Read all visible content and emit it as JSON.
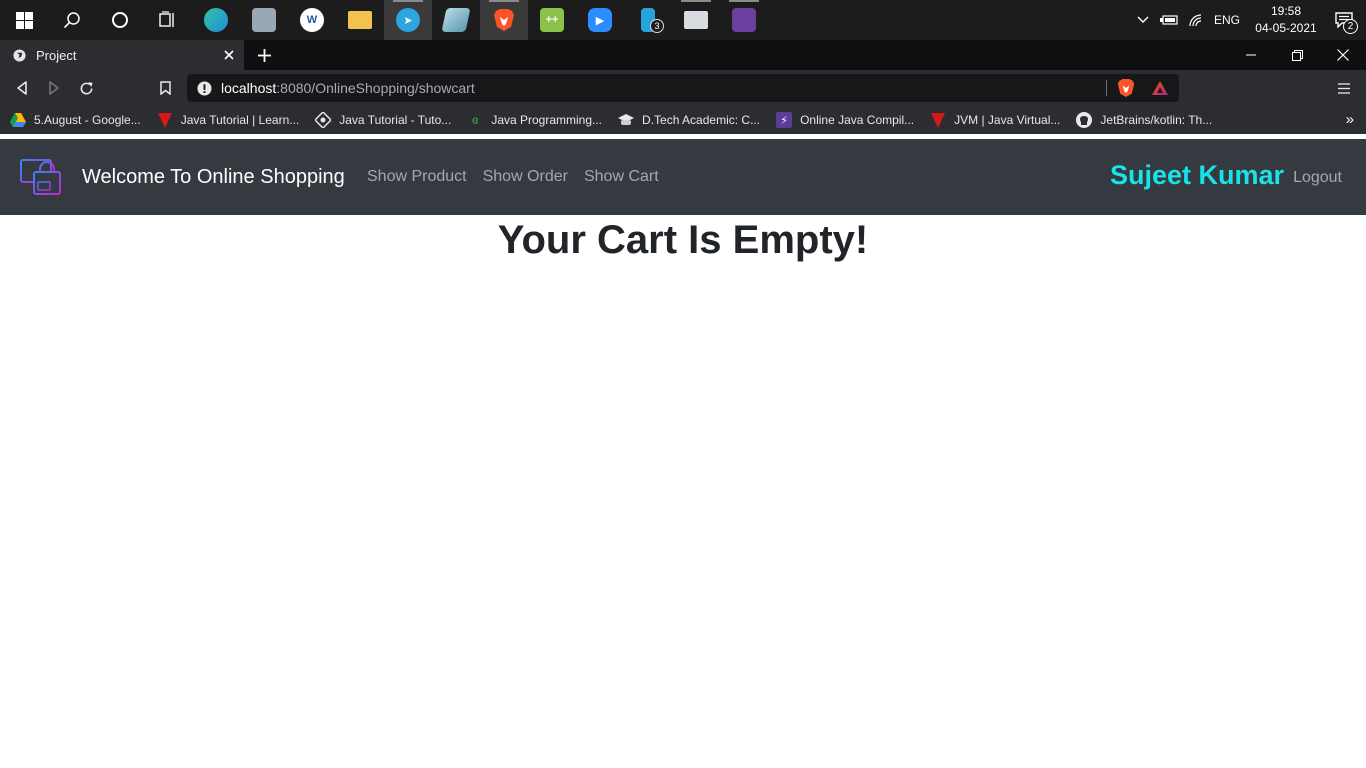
{
  "taskbar": {
    "apps": [
      {
        "icon": "edge-icon",
        "color": "#1e8fd8"
      },
      {
        "icon": "network-tool-icon",
        "color": "#9aa7b5"
      },
      {
        "icon": "word-icon",
        "color": "#ffffff"
      },
      {
        "icon": "file-explorer-icon",
        "color": "#f2c14e"
      },
      {
        "icon": "telegram-icon",
        "color": "#2ca5e0"
      },
      {
        "icon": "notes-app-icon",
        "color": "#8cc0d6"
      },
      {
        "icon": "brave-icon",
        "color": "#fb542b"
      },
      {
        "icon": "notepad-plus-icon",
        "color": "#8bc34a"
      },
      {
        "icon": "zoom-icon",
        "color": "#2d8cff"
      },
      {
        "icon": "phone-link-icon",
        "color": "#29a3e0"
      },
      {
        "icon": "news-app-icon",
        "color": "#d7dde3"
      },
      {
        "icon": "game-app-icon",
        "color": "#6b3fa0"
      }
    ],
    "phone_badge": "3",
    "language": "ENG",
    "time": "19:58",
    "date": "04-05-2021",
    "notification_count": "2"
  },
  "browser": {
    "tab_title": "Project",
    "url_host": "localhost",
    "url_path": ":8080/OnlineShopping/showcart",
    "bookmarks": [
      {
        "label": "5.August - Google...",
        "icon": "google-drive-icon"
      },
      {
        "label": "Java Tutorial | Learn...",
        "icon": "javatpoint-icon"
      },
      {
        "label": "Java Tutorial - Tuto...",
        "icon": "tutorialspoint-icon"
      },
      {
        "label": "Java Programming...",
        "icon": "geeksforgeeks-icon"
      },
      {
        "label": "D.Tech Academic: C...",
        "icon": "academic-cap-icon"
      },
      {
        "label": "Online Java Compil...",
        "icon": "compiler-icon"
      },
      {
        "label": "JVM | Java Virtual...",
        "icon": "javatpoint-icon"
      },
      {
        "label": "JetBrains/kotlin: Th...",
        "icon": "github-icon"
      }
    ],
    "bookmarks_more": "»"
  },
  "site": {
    "brand": "Welcome To Online Shopping",
    "nav": [
      "Show Product",
      "Show Order",
      "Show Cart"
    ],
    "user_name": "Sujeet Kumar",
    "logout": "Logout",
    "accent_color": "#17e3e8"
  },
  "content": {
    "message": "Your Cart Is Empty!"
  }
}
